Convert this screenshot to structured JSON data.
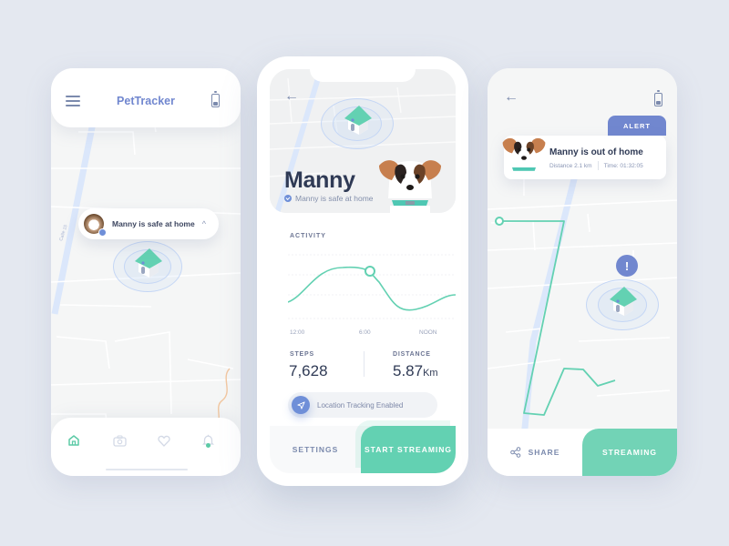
{
  "screen1": {
    "app_title": "PetTracker",
    "icons": {
      "menu": "hamburger-menu-icon",
      "battery": "battery-icon"
    },
    "map": {
      "street_label": "Calle 15"
    },
    "status_pill": {
      "text": "Manny is safe at home",
      "chevron": "^"
    },
    "nav": [
      {
        "name": "home",
        "icon": "home-icon",
        "active": true
      },
      {
        "name": "camera",
        "icon": "camera-icon",
        "active": false
      },
      {
        "name": "favorites",
        "icon": "heart-icon",
        "active": false
      },
      {
        "name": "notifications",
        "icon": "bell-icon",
        "active": false,
        "badge": true
      }
    ]
  },
  "screen2": {
    "back": "←",
    "pet_name": "Manny",
    "pet_status": "Manny is safe at home",
    "activity": {
      "label": "ACTIVITY",
      "ticks": [
        "12:00",
        "6:00",
        "NOON"
      ]
    },
    "stats": {
      "steps_label": "STEPS",
      "steps_value": "7,628",
      "distance_label": "DISTANCE",
      "distance_value": "5.87",
      "distance_unit": "Km"
    },
    "tracking_label": "Location Tracking Enabled",
    "buttons": {
      "settings": "SETTINGS",
      "start_streaming": "START STREAMING"
    }
  },
  "screen3": {
    "back": "←",
    "alert_tab": "ALERT",
    "alert": {
      "title": "Manny is out of home",
      "distance": "Distance 2.1 km",
      "time": "Time: 01:32:05"
    },
    "warning_glyph": "!",
    "buttons": {
      "share": "SHARE",
      "streaming": "STREAMING"
    }
  },
  "colors": {
    "background": "#e4e8f0",
    "accent_blue": "#7187cf",
    "accent_green": "#63d1b2",
    "text_dark": "#2f3a55",
    "text_muted": "#8a96b5"
  }
}
